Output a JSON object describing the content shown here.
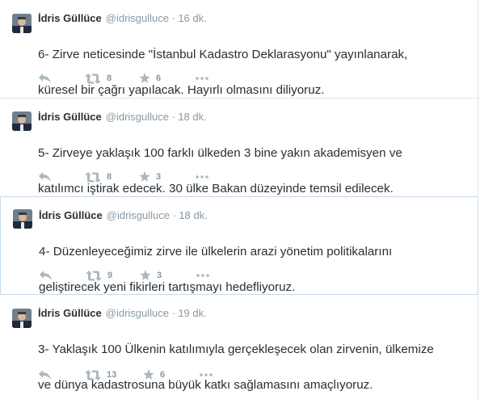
{
  "tweets": [
    {
      "name": "İdris Güllüce",
      "handle": "@idrisgulluce",
      "separator": "·",
      "time": "16 dk.",
      "text_line1": "6- Zirve neticesinde \"İstanbul Kadastro Deklarasyonu\" yayınlanarak,",
      "text_line2": "küresel bir çağrı yapılacak. Hayırlı olmasını diliyoruz.",
      "retweets": "8",
      "favorites": "6"
    },
    {
      "name": "İdris Güllüce",
      "handle": "@idrisgulluce",
      "separator": "·",
      "time": "18 dk.",
      "text_line1": "5- Zirveye yaklaşık 100 farklı ülkeden 3 bine yakın akademisyen ve",
      "text_line2": "katılımcı iştirak edecek. 30 ülke Bakan düzeyinde temsil edilecek.",
      "retweets": "8",
      "favorites": "3"
    },
    {
      "name": "İdris Güllüce",
      "handle": "@idrisgulluce",
      "separator": "·",
      "time": "18 dk.",
      "text_line1": "4- Düzenleyeceğimiz zirve ile ülkelerin arazi yönetim politikalarını",
      "text_line2": "geliştirecek yeni fikirleri tartışmayı hedefliyoruz.",
      "retweets": "9",
      "favorites": "3"
    },
    {
      "name": "İdris Güllüce",
      "handle": "@idrisgulluce",
      "separator": "·",
      "time": "19 dk.",
      "text_line1": "3- Yaklaşık 100 Ülkenin katılımıyla gerçekleşecek olan zirvenin, ülkemize",
      "text_line2": "ve dünya kadastrosuna  büyük katkı sağlamasını amaçlıyoruz.",
      "retweets": "13",
      "favorites": "6"
    }
  ],
  "icons": {
    "reply": "reply-icon",
    "retweet": "retweet-icon",
    "favorite": "star-icon",
    "more": "more-icon"
  },
  "colors": {
    "name": "#292f33",
    "meta": "#8899a6",
    "action_icon": "#aab8c2",
    "border": "#e1e8ed",
    "highlight_border": "#c5d9ea"
  }
}
